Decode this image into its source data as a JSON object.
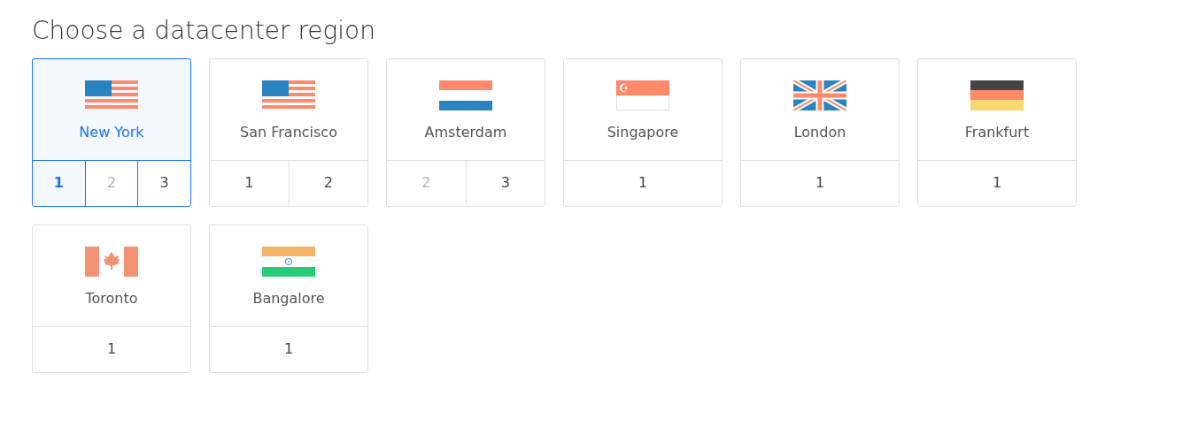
{
  "title": "Choose a datacenter region",
  "regions": [
    {
      "name": "New York",
      "kind": "us",
      "selected": true,
      "numbers": [
        {
          "label": "1",
          "selected": true,
          "disabled": false
        },
        {
          "label": "2",
          "selected": false,
          "disabled": true
        },
        {
          "label": "3",
          "selected": false,
          "disabled": false
        }
      ]
    },
    {
      "name": "San Francisco",
      "kind": "us",
      "selected": false,
      "numbers": [
        {
          "label": "1",
          "selected": false,
          "disabled": false
        },
        {
          "label": "2",
          "selected": false,
          "disabled": false
        }
      ]
    },
    {
      "name": "Amsterdam",
      "kind": "nl",
      "selected": false,
      "numbers": [
        {
          "label": "2",
          "selected": false,
          "disabled": true
        },
        {
          "label": "3",
          "selected": false,
          "disabled": false
        }
      ]
    },
    {
      "name": "Singapore",
      "kind": "sg",
      "selected": false,
      "numbers": [
        {
          "label": "1",
          "selected": false,
          "disabled": false
        }
      ]
    },
    {
      "name": "London",
      "kind": "uk",
      "selected": false,
      "numbers": [
        {
          "label": "1",
          "selected": false,
          "disabled": false
        }
      ]
    },
    {
      "name": "Frankfurt",
      "kind": "de",
      "selected": false,
      "numbers": [
        {
          "label": "1",
          "selected": false,
          "disabled": false
        }
      ]
    },
    {
      "name": "Toronto",
      "kind": "ca",
      "selected": false,
      "numbers": [
        {
          "label": "1",
          "selected": false,
          "disabled": false
        }
      ]
    },
    {
      "name": "Bangalore",
      "kind": "in",
      "selected": false,
      "numbers": [
        {
          "label": "1",
          "selected": false,
          "disabled": false
        }
      ]
    }
  ]
}
